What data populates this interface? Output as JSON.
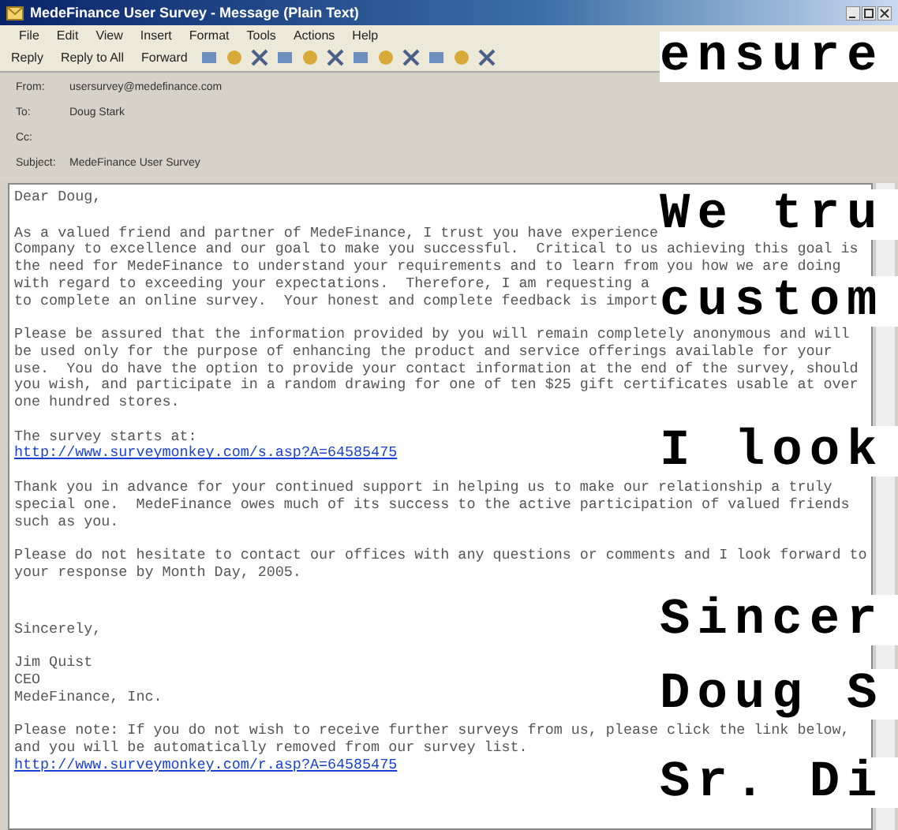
{
  "window": {
    "title": "MedeFinance User Survey - Message (Plain Text)"
  },
  "menu": [
    "File",
    "Edit",
    "View",
    "Insert",
    "Format",
    "Tools",
    "Actions",
    "Help"
  ],
  "toolbar": [
    {
      "kind": "text",
      "label": "Reply"
    },
    {
      "kind": "text",
      "label": "Reply to All"
    },
    {
      "kind": "text",
      "label": "Forward"
    }
  ],
  "header": [
    {
      "label": "From:",
      "value": "usersurvey@medefinance.com"
    },
    {
      "label": "To:",
      "value": "Doug Stark"
    },
    {
      "label": "Cc:"
    },
    {
      "label": "Subject:",
      "value": "MedeFinance User Survey"
    }
  ],
  "greeting": "Dear Doug,",
  "paragraphs": [
    {
      "lines": [
        {
          "kind": "text",
          "text": "As a valued friend and partner of MedeFinance, I trust you have experience"
        },
        {
          "kind": "text",
          "text": "Company to excellence and our goal to make you successful.  Critical to us achieving this goal is"
        },
        {
          "kind": "text",
          "text": "the need for MedeFinance to understand your requirements and to learn from you how we are doing"
        },
        {
          "kind": "text",
          "text": "with regard to exceeding your expectations.  Therefore, I am requesting a"
        },
        {
          "kind": "text",
          "text": "to complete an online survey.  Your honest and complete feedback is import"
        }
      ]
    },
    {
      "lines": [
        {
          "kind": "text",
          "text": "Please be assured that the information provided by you will remain completely anonymous and will"
        },
        {
          "kind": "text",
          "text": "be used only for the purpose of enhancing the product and service offerings available for your"
        },
        {
          "kind": "text",
          "text": "use.  You do have the option to provide your contact information at the end of the survey, should"
        },
        {
          "kind": "text",
          "text": "you wish, and participate in a random drawing for one of ten $25 gift certificates usable at over"
        },
        {
          "kind": "text",
          "text": "one hundred stores."
        }
      ]
    },
    {
      "lines": [
        {
          "kind": "text",
          "text": "The survey starts at:"
        },
        {
          "kind": "link",
          "text": "http://www.surveymonkey.com/s.asp?A=64585475"
        }
      ]
    },
    {
      "lines": [
        {
          "kind": "text",
          "text": "Thank you in advance for your continued support in helping us to make our relationship a truly"
        },
        {
          "kind": "text",
          "text": "special one.  MedeFinance owes much of its success to the active participation of valued friends"
        },
        {
          "kind": "text",
          "text": "such as you."
        }
      ]
    },
    {
      "lines": [
        {
          "kind": "text",
          "text": "Please do not hesitate to contact our offices with any questions or comments and I look forward to"
        },
        {
          "kind": "text",
          "text": "your response by Month Day, 2005."
        }
      ]
    },
    {
      "lines": [
        {
          "kind": "text",
          "text": "Sincerely,"
        }
      ]
    },
    {
      "lines": [
        {
          "kind": "text",
          "text": "Jim Quist"
        },
        {
          "kind": "text",
          "text": "CEO"
        },
        {
          "kind": "text",
          "text": "MedeFinance, Inc."
        }
      ]
    },
    {
      "lines": [
        {
          "kind": "text",
          "text": "Please note: If you do not wish to receive further surveys from us, please click the link below,"
        },
        {
          "kind": "text",
          "text": "and you will be automatically removed from our survey list."
        },
        {
          "kind": "link",
          "text": "http://www.surveymonkey.com/r.asp?A=64585475"
        }
      ]
    }
  ],
  "overlay": [
    "ensure",
    "We tru",
    "custom",
    "I look",
    "Sincer",
    "Doug S",
    "Sr. Di"
  ]
}
